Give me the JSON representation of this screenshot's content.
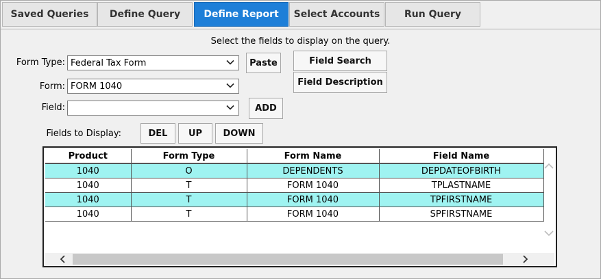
{
  "tabs": [
    {
      "label": "Saved Queries"
    },
    {
      "label": "Define Query"
    },
    {
      "label": "Define Report"
    },
    {
      "label": "Select Accounts"
    },
    {
      "label": "Run Query"
    }
  ],
  "active_tab": "Define Report",
  "instruction": "Select the fields to display on the query.",
  "form_type": {
    "label": "Form Type:",
    "value": "Federal Tax Form"
  },
  "form": {
    "label": "Form:",
    "value": "FORM 1040"
  },
  "field": {
    "label": "Field:",
    "value": ""
  },
  "buttons": {
    "paste": "Paste",
    "field_search": "Field Search",
    "field_description": "Field Description",
    "add": "ADD",
    "del": "DEL",
    "up": "UP",
    "down": "DOWN"
  },
  "fields_to_display_label": "Fields to Display:",
  "table": {
    "columns": [
      "Product",
      "Form Type",
      "Form Name",
      "Field Name"
    ],
    "rows": [
      {
        "product": "1040",
        "form_type": "O",
        "form_name": "DEPENDENTS",
        "field_name": "DEPDATEOFBIRTH",
        "highlighted": true
      },
      {
        "product": "1040",
        "form_type": "T",
        "form_name": "FORM 1040",
        "field_name": "TPLASTNAME",
        "highlighted": false
      },
      {
        "product": "1040",
        "form_type": "T",
        "form_name": "FORM 1040",
        "field_name": "TPFIRSTNAME",
        "highlighted": true
      },
      {
        "product": "1040",
        "form_type": "T",
        "form_name": "FORM 1040",
        "field_name": "SPFIRSTNAME",
        "highlighted": false
      }
    ]
  },
  "colors": {
    "active_tab": "#1e7fd8",
    "row_highlight": "#9ff3f1"
  }
}
